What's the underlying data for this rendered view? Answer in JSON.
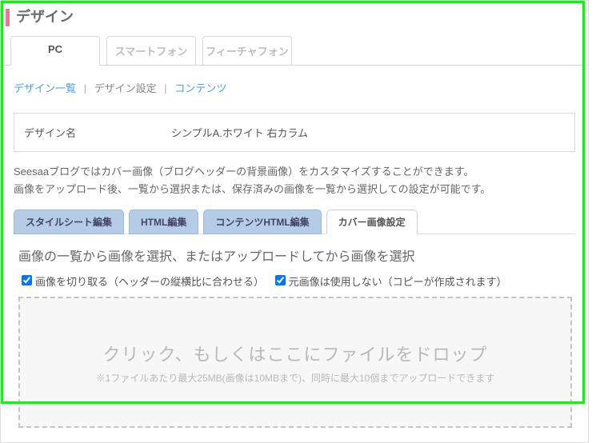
{
  "header": {
    "title": "デザイン"
  },
  "deviceTabs": [
    "PC",
    "スマートフォン",
    "フィーチャフォン"
  ],
  "crumbs": {
    "list": "デザイン一覧",
    "settings": "デザイン設定",
    "contents": "コンテンツ"
  },
  "form": {
    "nameLabel": "デザイン名",
    "nameValue": "シンプルA.ホワイト 右カラム"
  },
  "desc": {
    "line1": "Seesaaブログではカバー画像（ブログヘッダーの背景画像）をカスタマイズすることができます。",
    "line2": "画像をアップロード後、一覧から選択または、保存済みの画像を一覧から選択しての設定が可能です。"
  },
  "subTabs": [
    "スタイルシート編集",
    "HTML編集",
    "コンテンツHTML編集",
    "カバー画像設定"
  ],
  "section": {
    "header": "画像の一覧から画像を選択、またはアップロードしてから画像を選択",
    "chk1": "画像を切り取る（ヘッダーの縦横比に合わせる）",
    "chk2": "元画像は使用しない（コピーが作成されます）"
  },
  "drop": {
    "big": "クリック、もしくはここにファイルをドロップ",
    "small": "※1ファイルあたり最大25MB(画像は10MBまで)、同時に最大10個までアップロードできます"
  }
}
